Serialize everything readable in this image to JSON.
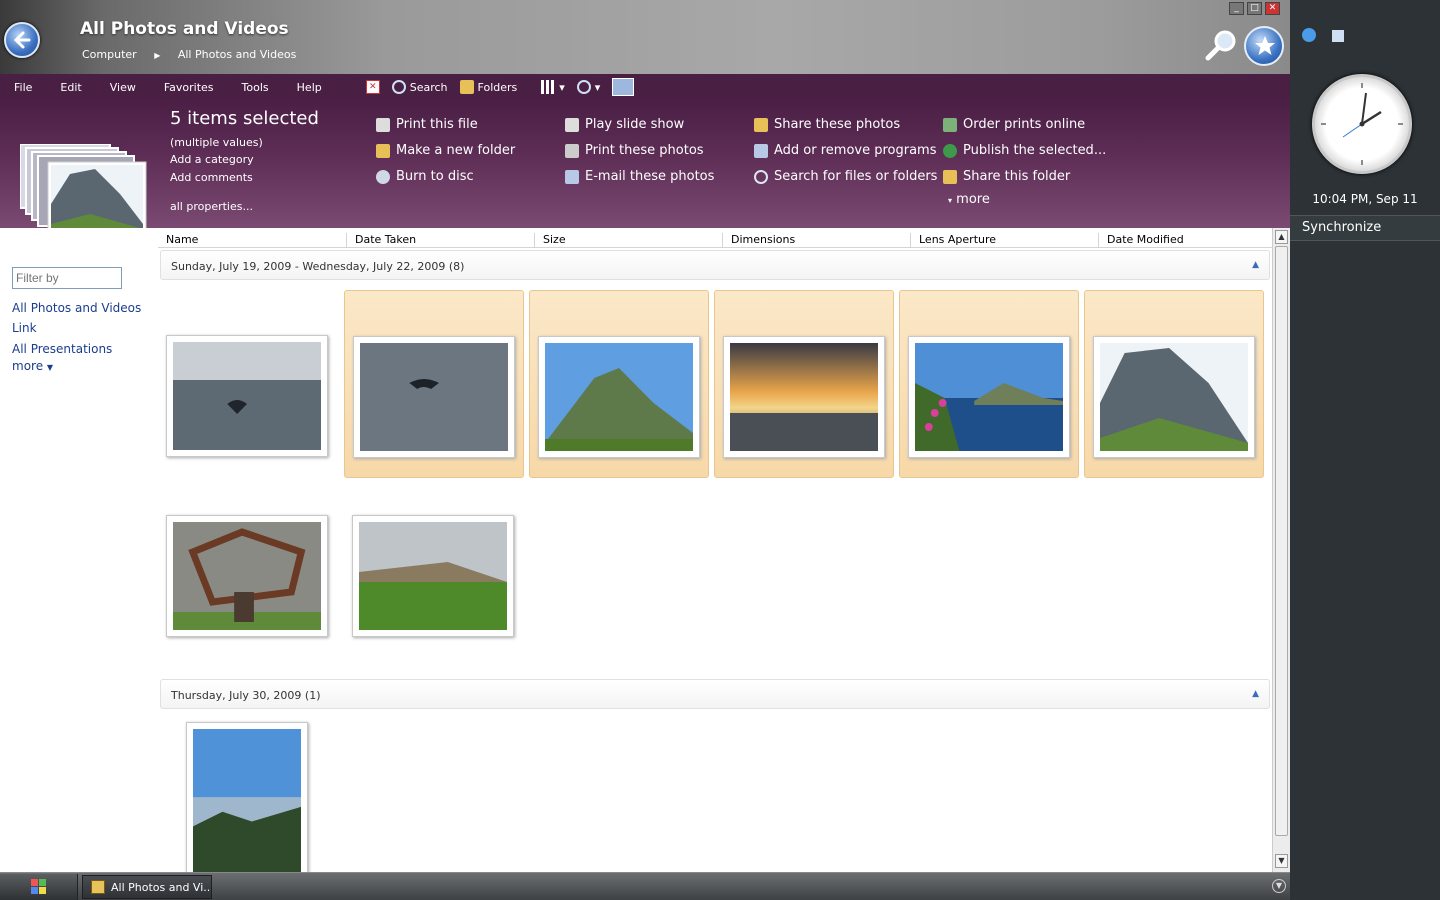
{
  "window": {
    "title": "All Photos and Videos",
    "breadcrumb": [
      "Computer",
      "All Photos and Videos"
    ],
    "controls": [
      "minimize",
      "maximize",
      "close"
    ]
  },
  "menubar": {
    "menus": [
      "File",
      "Edit",
      "View",
      "Favorites",
      "Tools",
      "Help"
    ],
    "search_label": "Search",
    "folders_label": "Folders"
  },
  "details": {
    "title": "5 items selected",
    "values": "(multiple values)",
    "add_category": "Add a category",
    "add_comments": "Add comments",
    "all_properties": "all properties..."
  },
  "tasks": {
    "col1": [
      "Print this file",
      "Make a new folder",
      "Burn to disc"
    ],
    "col2": [
      "Play slide show",
      "Print these photos",
      "E-mail these photos"
    ],
    "col3": [
      "Share these photos",
      "Add or remove programs",
      "Search for files or folders"
    ],
    "col4": [
      "Order prints online",
      "Publish the selected...",
      "Share this folder"
    ],
    "more": "more"
  },
  "leftpane": {
    "filter_placeholder": "Filter by",
    "links": [
      "All Photos and Videos",
      "Link",
      "All Presentations"
    ],
    "more": "more"
  },
  "columns": [
    "Name",
    "Date Taken",
    "Size",
    "Dimensions",
    "Lens Aperture",
    "Date Modified"
  ],
  "groups": [
    {
      "label": "Sunday, July 19, 2009 - Wednesday, July 22, 2009 (8)"
    },
    {
      "label": "Thursday, July 30, 2009 (1)"
    }
  ],
  "sidebar": {
    "clock_time": "10:04 PM, Sep 11",
    "sync_label": "Synchronize"
  },
  "taskbar": {
    "task_label": "All Photos and Vi..."
  }
}
